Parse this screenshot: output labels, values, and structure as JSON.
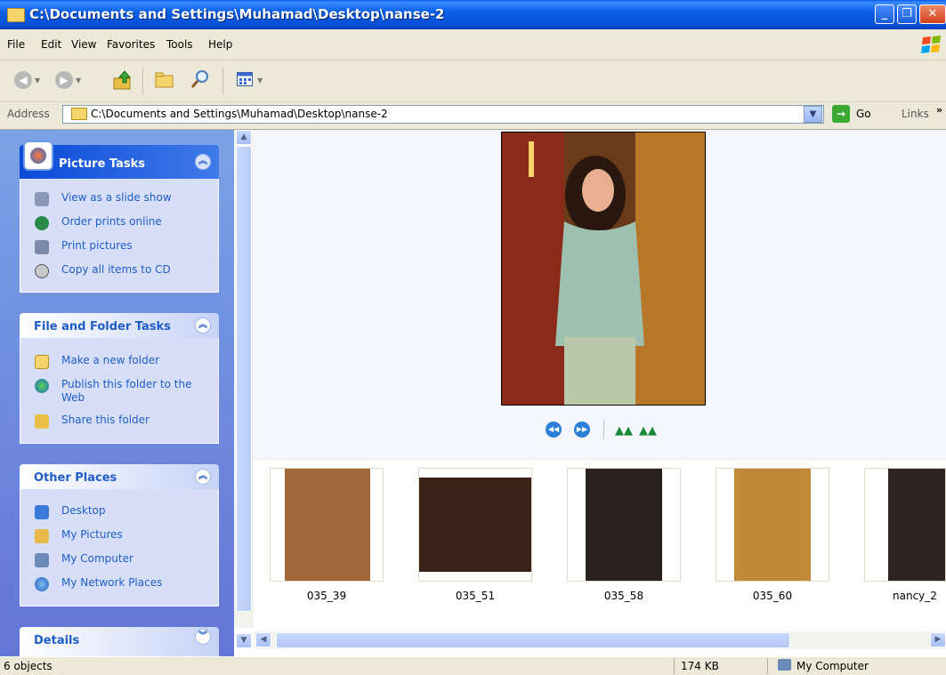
{
  "window": {
    "title": "C:\\Documents and Settings\\Muhamad\\Desktop\\nanse-2",
    "minimize_glyph": "_",
    "maximize_glyph": "❐",
    "close_glyph": "✕"
  },
  "menu": [
    "File",
    "Edit",
    "View",
    "Favorites",
    "Tools",
    "Help"
  ],
  "toolbar": {
    "back_icon": "back-arrow-icon",
    "forward_icon": "forward-arrow-icon",
    "up_icon": "up-folder-icon",
    "folders_icon": "folders-icon",
    "search_icon": "search-icon",
    "views_icon": "views-icon"
  },
  "address": {
    "label": "Address",
    "value": "C:\\Documents and Settings\\Muhamad\\Desktop\\nanse-2",
    "go_label": "Go",
    "links_label": "Links"
  },
  "sidebar": {
    "picture_tasks": {
      "title": "Picture Tasks",
      "items": [
        "View as a slide show",
        "Order prints online",
        "Print pictures",
        "Copy all items to CD"
      ]
    },
    "file_folder_tasks": {
      "title": "File and Folder Tasks",
      "items": [
        "Make a new folder",
        "Publish this folder to the Web",
        "Share this folder"
      ]
    },
    "other_places": {
      "title": "Other Places",
      "items": [
        "Desktop",
        "My Pictures",
        "My Computer",
        "My Network Places"
      ]
    },
    "details": {
      "title": "Details"
    }
  },
  "thumbnails": [
    {
      "label": "035_39",
      "color": "#a0683a"
    },
    {
      "label": "035_51",
      "color": "#3b2218"
    },
    {
      "label": "035_58",
      "color": "#2a2220"
    },
    {
      "label": "035_60",
      "color": "#c08a3a"
    },
    {
      "label": "nancy_2",
      "color": "#2e2424"
    }
  ],
  "status": {
    "count": "6 objects",
    "size": "174 KB",
    "zone": "My Computer"
  },
  "colors": {
    "titlebar": "#0a5ae8",
    "sidebar": "#7ba2e7",
    "link": "#215dc6"
  }
}
